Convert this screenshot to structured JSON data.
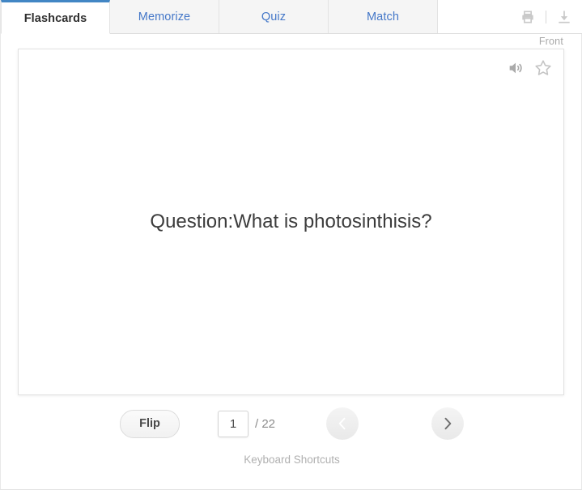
{
  "tabs": [
    {
      "label": "Flashcards",
      "active": true
    },
    {
      "label": "Memorize",
      "active": false
    },
    {
      "label": "Quiz",
      "active": false
    },
    {
      "label": "Match",
      "active": false
    }
  ],
  "header_tools": {
    "print_icon": "print-icon",
    "download_icon": "download-icon"
  },
  "card": {
    "side_label": "Front",
    "text": "Question:What is photosinthisis?",
    "audio_icon": "speaker-icon",
    "star_icon": "star-outline-icon"
  },
  "controls": {
    "flip_label": "Flip",
    "page_value": "1",
    "page_total": "/ 22",
    "prev_icon": "chevron-left-icon",
    "next_icon": "chevron-right-icon",
    "prev_disabled": true
  },
  "footer": {
    "keyboard_shortcuts": "Keyboard Shortcuts"
  },
  "colors": {
    "accent": "#4286c4",
    "tab_link": "#4477c8",
    "text": "#3c3c3c",
    "muted": "#b0b0b0"
  }
}
